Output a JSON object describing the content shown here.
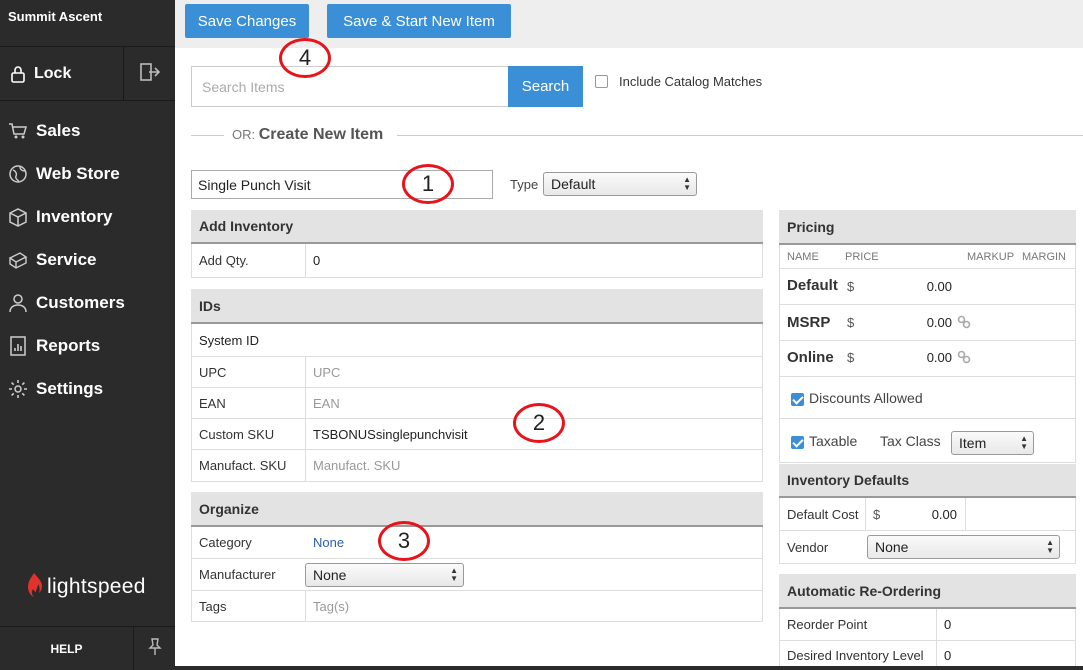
{
  "sidebar": {
    "brand": "Summit Ascent",
    "lock_label": "Lock",
    "nav": [
      {
        "label": "Sales",
        "icon": "cart-icon"
      },
      {
        "label": "Web Store",
        "icon": "globe-icon"
      },
      {
        "label": "Inventory",
        "icon": "box-icon"
      },
      {
        "label": "Service",
        "icon": "ticket-icon"
      },
      {
        "label": "Customers",
        "icon": "user-icon"
      },
      {
        "label": "Reports",
        "icon": "report-icon"
      },
      {
        "label": "Settings",
        "icon": "gear-icon"
      }
    ],
    "logo_text": "lightspeed",
    "help_label": "HELP"
  },
  "toolbar": {
    "save_label": "Save Changes",
    "save_new_label": "Save & Start New Item"
  },
  "annotations": [
    "1",
    "2",
    "3",
    "4"
  ],
  "search": {
    "placeholder": "Search Items",
    "button_label": "Search",
    "include_catalog_label": "Include Catalog Matches",
    "include_catalog_checked": false
  },
  "create": {
    "or_prefix": "OR:",
    "title": "Create New Item",
    "name_value": "Single Punch Visit",
    "type_label": "Type",
    "type_value": "Default"
  },
  "add_inventory": {
    "title": "Add Inventory",
    "qty_label": "Add Qty.",
    "qty_value": "0"
  },
  "ids": {
    "title": "IDs",
    "system_id_label": "System ID",
    "system_id_value": "",
    "upc_label": "UPC",
    "upc_placeholder": "UPC",
    "ean_label": "EAN",
    "ean_placeholder": "EAN",
    "custom_sku_label": "Custom SKU",
    "custom_sku_value": "TSBONUSsinglepunchvisit",
    "manufact_sku_label": "Manufact. SKU",
    "manufact_sku_placeholder": "Manufact. SKU"
  },
  "organize": {
    "title": "Organize",
    "category_label": "Category",
    "category_value": "None",
    "manufacturer_label": "Manufacturer",
    "manufacturer_value": "None",
    "tags_label": "Tags",
    "tags_placeholder": "Tag(s)"
  },
  "pricing": {
    "title": "Pricing",
    "col_name": "NAME",
    "col_price": "PRICE",
    "col_markup": "MARKUP",
    "col_margin": "MARGIN",
    "rows": [
      {
        "name": "Default",
        "currency": "$",
        "price": "0.00"
      },
      {
        "name": "MSRP",
        "currency": "$",
        "price": "0.00"
      },
      {
        "name": "Online",
        "currency": "$",
        "price": "0.00"
      }
    ],
    "discounts_label": "Discounts Allowed",
    "discounts_checked": true,
    "taxable_label": "Taxable",
    "taxable_checked": true,
    "tax_class_label": "Tax Class",
    "tax_class_value": "Item"
  },
  "inventory_defaults": {
    "title": "Inventory Defaults",
    "default_cost_label": "Default Cost",
    "default_cost_currency": "$",
    "default_cost_value": "0.00",
    "vendor_label": "Vendor",
    "vendor_value": "None"
  },
  "reordering": {
    "title": "Automatic Re-Ordering",
    "reorder_point_label": "Reorder Point",
    "reorder_point_value": "0",
    "desired_level_label": "Desired Inventory Level",
    "desired_level_value": "0"
  },
  "colors": {
    "sidebar_bg": "#2b2b2b",
    "primary": "#3b8fd6",
    "annotation": "#e8141b",
    "logo": "#e1332d"
  }
}
